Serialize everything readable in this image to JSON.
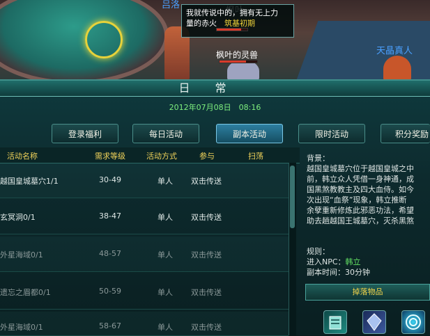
{
  "scene": {
    "npc_top_left": "吕洛",
    "player_name": "枫叶",
    "chat_bubble_a": "我就传说中的，拥有无上力",
    "chat_bubble_b": "量的赤火",
    "chat_pun": "筑基初期",
    "pet_name": "枫叶的灵兽",
    "npc_right": "天晶真人",
    "player_hp": 0.8,
    "pet_hp": 0.7
  },
  "panel": {
    "title": "日常",
    "datetime": "2012年07月08日　08:16",
    "tabs": [
      "登录福利",
      "每日活动",
      "副本活动",
      "限时活动",
      "积分奖励"
    ],
    "active_tab": 2,
    "columns": [
      "活动名称",
      "需求等级",
      "活动方式",
      "参与",
      "扫荡"
    ],
    "rows": [
      {
        "name": "越国皇城墓穴1/1",
        "level": "30-49",
        "mode": "单人",
        "join": "双击传送",
        "dim": false
      },
      {
        "name": "玄冥洞0/1",
        "level": "38-47",
        "mode": "单人",
        "join": "双击传送",
        "dim": false
      },
      {
        "name": "外星海域0/1",
        "level": "48-57",
        "mode": "单人",
        "join": "双击传送",
        "dim": true
      },
      {
        "name": "遗忘之眉都0/1",
        "level": "50-59",
        "mode": "单人",
        "join": "双击传送",
        "dim": true
      },
      {
        "name": "外星海域0/1",
        "level": "58-67",
        "mode": "单人",
        "join": "双击传送",
        "dim": true
      }
    ],
    "detail": {
      "background_label": "背景：",
      "background_text": "越国皇城墓穴位于越国皇城之中\n前，韩立众人凭借一身神通，成\n国黑煞教教主及四大血侍。如今\n次出现“血祭”现象，韩立推断\n余孽重新修炼此邪恶功法，希望\n助去趟越国王城墓穴，灭杀黑煞",
      "rules_label": "规则：",
      "npc_label": "进入NPC：",
      "npc_name": "韩立",
      "time_label": "副本时间：",
      "time_value": "30分钟",
      "drops_label": "掉落物品"
    },
    "drop_icons": [
      "scroll-icon",
      "crystal-icon",
      "spiral-orb-icon"
    ]
  }
}
